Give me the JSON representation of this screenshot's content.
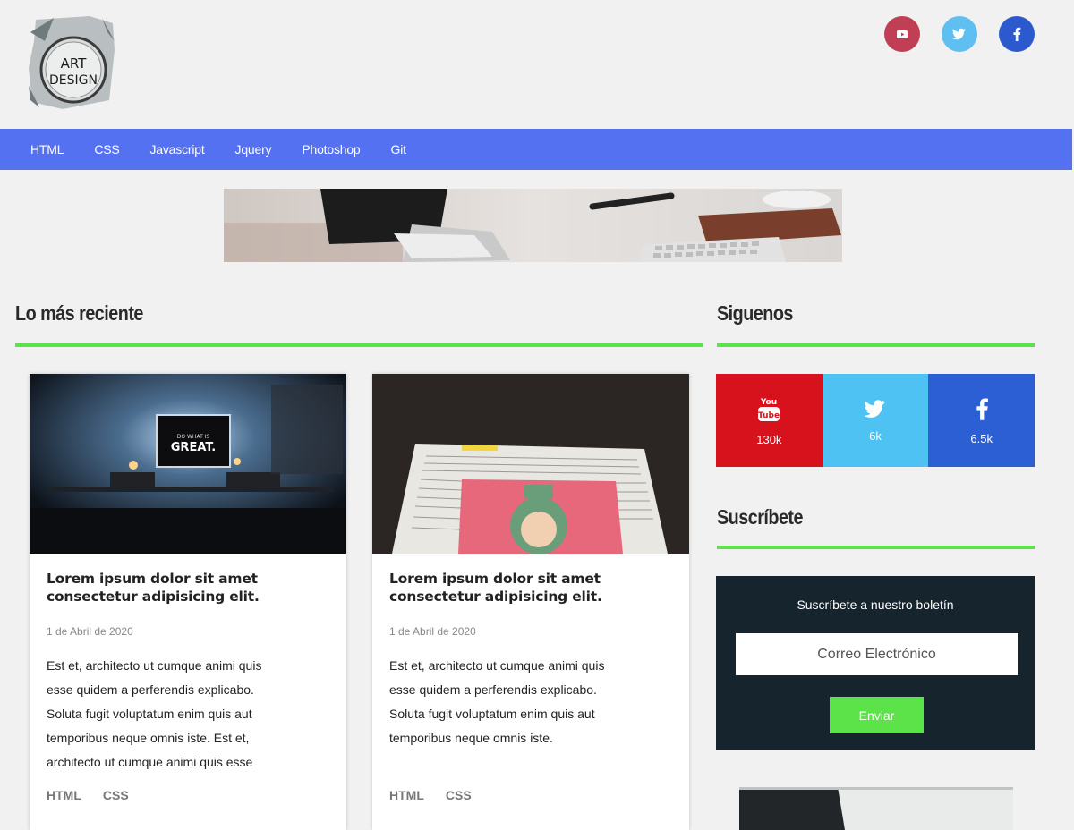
{
  "logo": {
    "line1": "ART",
    "line2": "DESIGN"
  },
  "header_social": [
    {
      "name": "youtube",
      "icon": "youtube-icon",
      "color": "#c03f55"
    },
    {
      "name": "twitter",
      "icon": "twitter-icon",
      "color": "#5ebff0"
    },
    {
      "name": "facebook",
      "icon": "facebook-icon",
      "color": "#2d59cf"
    }
  ],
  "nav": {
    "items": [
      "HTML",
      "CSS",
      "Javascript",
      "Jquery",
      "Photoshop",
      "Git"
    ],
    "color": "#5471f2"
  },
  "latest": {
    "title": "Lo más reciente",
    "cards": [
      {
        "title": "Lorem ipsum dolor sit amet consectetur adipisicing elit.",
        "image_text": [
          "DO WHAT IS",
          "GREAT."
        ],
        "date": "1 de Abril de 2020",
        "desc_lines": [
          "Est et, architecto ut cumque animi quis",
          "esse quidem a perferendis explicabo.",
          "Soluta fugit voluptatum enim quis aut",
          "temporibus neque omnis iste. Est et,",
          "architecto ut cumque animi quis esse"
        ],
        "tags": [
          "HTML",
          "CSS"
        ]
      },
      {
        "title": "Lorem ipsum dolor sit amet consectetur adipisicing elit.",
        "date": "1 de Abril de 2020",
        "desc_lines": [
          "Est et, architecto ut cumque animi quis",
          "esse quidem a perferendis explicabo.",
          "Soluta fugit voluptatum enim quis aut",
          "temporibus neque omnis iste."
        ],
        "tags": [
          "HTML",
          "CSS"
        ]
      }
    ]
  },
  "follow": {
    "title": "Siguenos",
    "boxes": [
      {
        "network": "youtube",
        "icon": "youtube-icon",
        "count": "130k",
        "color": "#d8121d"
      },
      {
        "network": "twitter",
        "icon": "twitter-icon",
        "count": "6k",
        "color": "#4dc2f3"
      },
      {
        "network": "facebook",
        "icon": "facebook-icon",
        "count": "6.5k",
        "color": "#2c5fd4"
      }
    ]
  },
  "subscribe": {
    "title": "Suscríbete",
    "label": "Suscríbete a nuestro boletín",
    "placeholder": "Correo Electrónico",
    "button": "Enviar",
    "bg": "#16242e",
    "accent": "#5ce34a"
  }
}
